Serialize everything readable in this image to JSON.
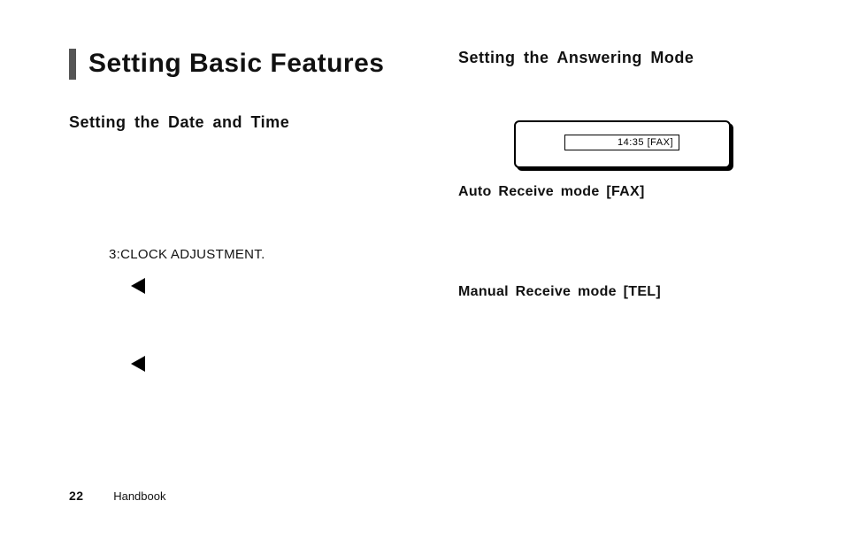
{
  "chapter_title": "Setting Basic Features",
  "left": {
    "section_title": "Setting the Date and Time",
    "clock_label": "3:CLOCK ADJUSTMENT."
  },
  "right": {
    "section_title": "Setting the Answering Mode",
    "display_text": "14:35 [FAX]",
    "auto_mode": "Auto Receive mode [FAX]",
    "manual_mode": "Manual Receive mode [TEL]"
  },
  "footer": {
    "page_number": "22",
    "label": "Handbook"
  }
}
